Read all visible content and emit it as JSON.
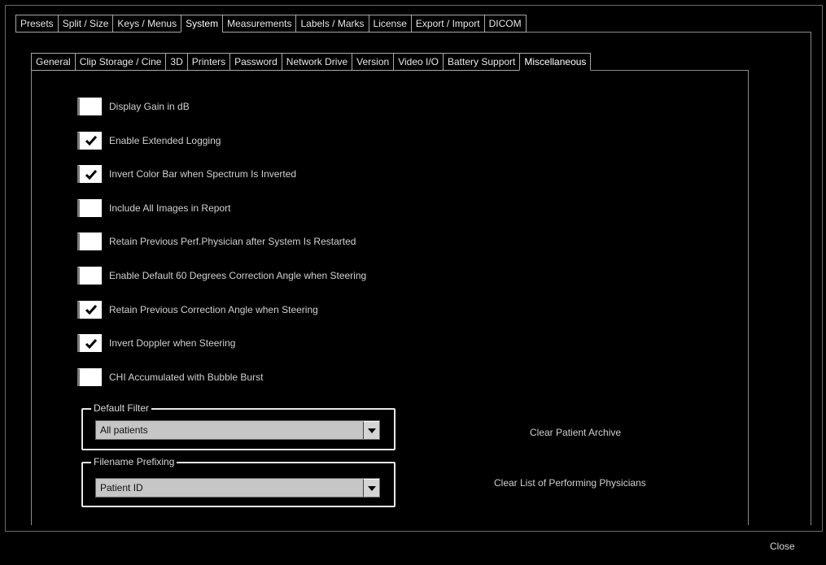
{
  "top_tabs": [
    {
      "label": "Presets"
    },
    {
      "label": "Split / Size"
    },
    {
      "label": "Keys / Menus"
    },
    {
      "label": "System",
      "active": true
    },
    {
      "label": "Measurements"
    },
    {
      "label": "Labels / Marks"
    },
    {
      "label": "License"
    },
    {
      "label": "Export / Import"
    },
    {
      "label": "DICOM"
    }
  ],
  "sub_tabs": [
    {
      "label": "General"
    },
    {
      "label": "Clip Storage / Cine"
    },
    {
      "label": "3D"
    },
    {
      "label": "Printers"
    },
    {
      "label": "Password"
    },
    {
      "label": "Network Drive"
    },
    {
      "label": "Version"
    },
    {
      "label": "Video I/O"
    },
    {
      "label": "Battery Support"
    },
    {
      "label": "Miscellaneous",
      "active": true
    }
  ],
  "options": [
    {
      "label": "Display Gain in dB",
      "checked": false
    },
    {
      "label": "Enable Extended Logging",
      "checked": true
    },
    {
      "label": "Invert Color Bar when Spectrum Is Inverted",
      "checked": true
    },
    {
      "label": "Include All Images in Report",
      "checked": false
    },
    {
      "label": "Retain Previous Perf.Physician after System Is Restarted",
      "checked": false
    },
    {
      "label": "Enable Default 60 Degrees Correction Angle when Steering",
      "checked": false
    },
    {
      "label": "Retain Previous Correction Angle when Steering",
      "checked": true
    },
    {
      "label": "Invert Doppler when Steering",
      "checked": true
    },
    {
      "label": "CHI Accumulated with Bubble Burst",
      "checked": false
    }
  ],
  "default_filter": {
    "title": "Default Filter",
    "value": "All patients"
  },
  "filename_prefixing": {
    "title": "Filename Prefixing",
    "value": "Patient ID"
  },
  "actions": {
    "clear_archive": "Clear Patient Archive",
    "clear_physicians": "Clear List of Performing Physicians"
  },
  "close_label": "Close"
}
